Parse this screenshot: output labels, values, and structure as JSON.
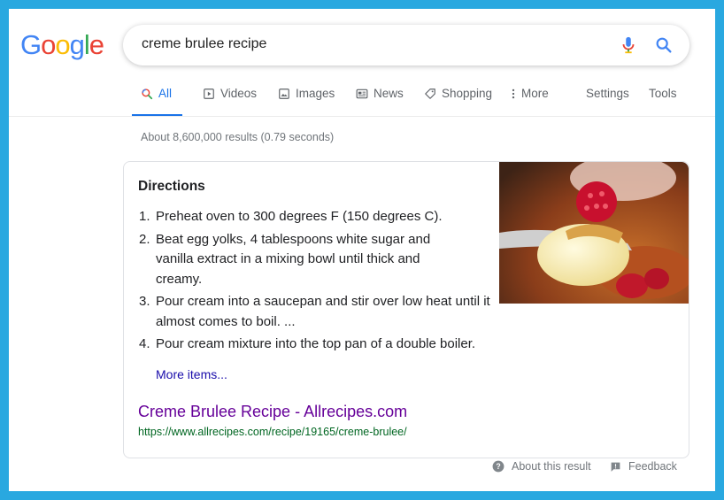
{
  "logo": {
    "letters": [
      "G",
      "o",
      "o",
      "g",
      "l",
      "e"
    ],
    "colors": [
      "#4285f4",
      "#ea4335",
      "#fbbc05",
      "#4285f4",
      "#34a853",
      "#ea4335"
    ]
  },
  "search": {
    "query": "creme brulee recipe",
    "mic_icon": "microphone-icon",
    "search_icon": "magnifier-icon"
  },
  "tabs": [
    {
      "label": "All",
      "icon": "search-icon",
      "active": true
    },
    {
      "label": "Videos",
      "icon": "play-icon"
    },
    {
      "label": "Images",
      "icon": "image-icon"
    },
    {
      "label": "News",
      "icon": "news-icon"
    },
    {
      "label": "Shopping",
      "icon": "tag-icon"
    },
    {
      "label": "More",
      "icon": "more-vert-icon"
    },
    {
      "label": "Settings"
    },
    {
      "label": "Tools"
    }
  ],
  "stats": "About 8,600,000 results (0.79 seconds)",
  "snippet": {
    "heading": "Directions",
    "steps": [
      {
        "num": "1.",
        "text": "Preheat oven to 300 degrees F (150 degrees C)."
      },
      {
        "num": "2.",
        "text": "Beat egg yolks, 4 tablespoons white sugar and vanilla extract in a mixing bowl until thick and creamy."
      },
      {
        "num": "3.",
        "text": "Pour cream into a saucepan and stir over low heat until it almost comes to boil. ..."
      },
      {
        "num": "4.",
        "text": "Pour cream mixture into the top pan of a double boiler."
      }
    ],
    "more_items": "More items...",
    "result_title": "Creme Brulee Recipe - Allrecipes.com",
    "result_url": "https://www.allrecipes.com/recipe/19165/creme-brulee/"
  },
  "footer": {
    "about": "About this result",
    "feedback": "Feedback"
  },
  "colors": {
    "link": "#1a0dab",
    "visited": "#660099",
    "url": "#006621",
    "accent": "#1a73e8",
    "frame": "#29a8e0"
  }
}
